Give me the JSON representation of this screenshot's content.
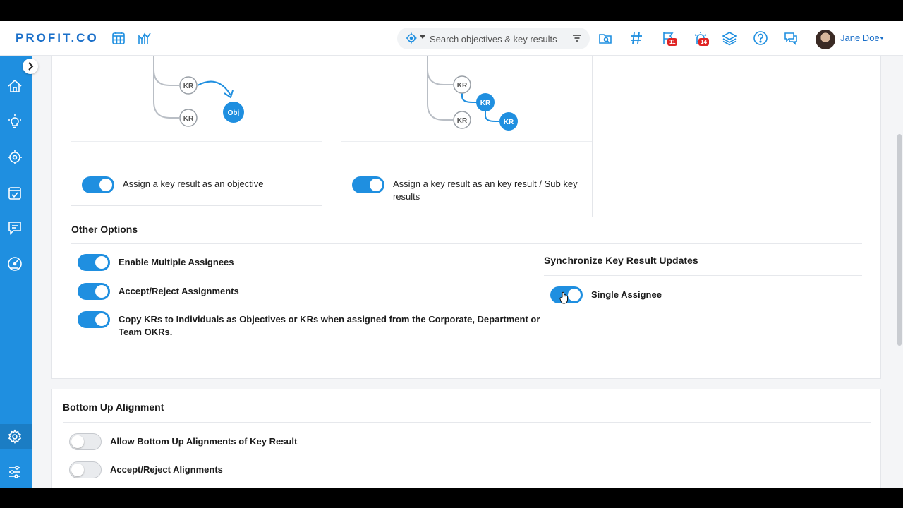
{
  "header": {
    "logo": "PROFIT.CO",
    "search": {
      "placeholder": "Search objectives & key results"
    },
    "flag_badge": "11",
    "alarm_badge": "14",
    "user_name": "Jane Doe"
  },
  "cards": [
    {
      "diagram": {
        "nodes": [
          "KR",
          "KR",
          "Obj"
        ]
      },
      "toggle_on": true,
      "label": "Assign a key result as an objective"
    },
    {
      "diagram": {
        "nodes": [
          "KR",
          "KR",
          "KR",
          "KR"
        ]
      },
      "toggle_on": true,
      "label_line1": "Assign a key result as an key result / Sub key",
      "label_line2": "results"
    }
  ],
  "other_options": {
    "title": "Other Options",
    "items": [
      {
        "label": "Enable Multiple Assignees",
        "on": true
      },
      {
        "label": "Accept/Reject Assignments",
        "on": true
      },
      {
        "label_line1": "Copy KRs to Individuals as Objectives or KRs when assigned from the Corporate, Department or",
        "label_line2": "Team OKRs.",
        "on": true
      }
    ]
  },
  "sync": {
    "title": "Synchronize Key Result Updates",
    "items": [
      {
        "label": "Single Assignee",
        "on": true
      }
    ]
  },
  "bottom_up": {
    "title": "Bottom Up Alignment",
    "items": [
      {
        "label": "Allow Bottom Up Alignments of Key Result",
        "on": false
      },
      {
        "label": "Accept/Reject Alignments",
        "on": false
      }
    ]
  },
  "colors": {
    "accent": "#1f8fe0",
    "brand": "#1a6fc9",
    "badge": "#e02424"
  },
  "icons": {
    "header": [
      "calendar-grid-icon",
      "chart-icon",
      "target-icon",
      "filter-icon",
      "folder-search-icon",
      "hashtag-icon",
      "flag-icon",
      "alarm-icon",
      "layers-icon",
      "help-icon",
      "chat-icon"
    ],
    "sidebar": [
      "home-icon",
      "lightbulb-icon",
      "target-icon",
      "calendar-check-icon",
      "message-icon",
      "gauge-icon",
      "gear-icon",
      "sliders-icon"
    ]
  }
}
